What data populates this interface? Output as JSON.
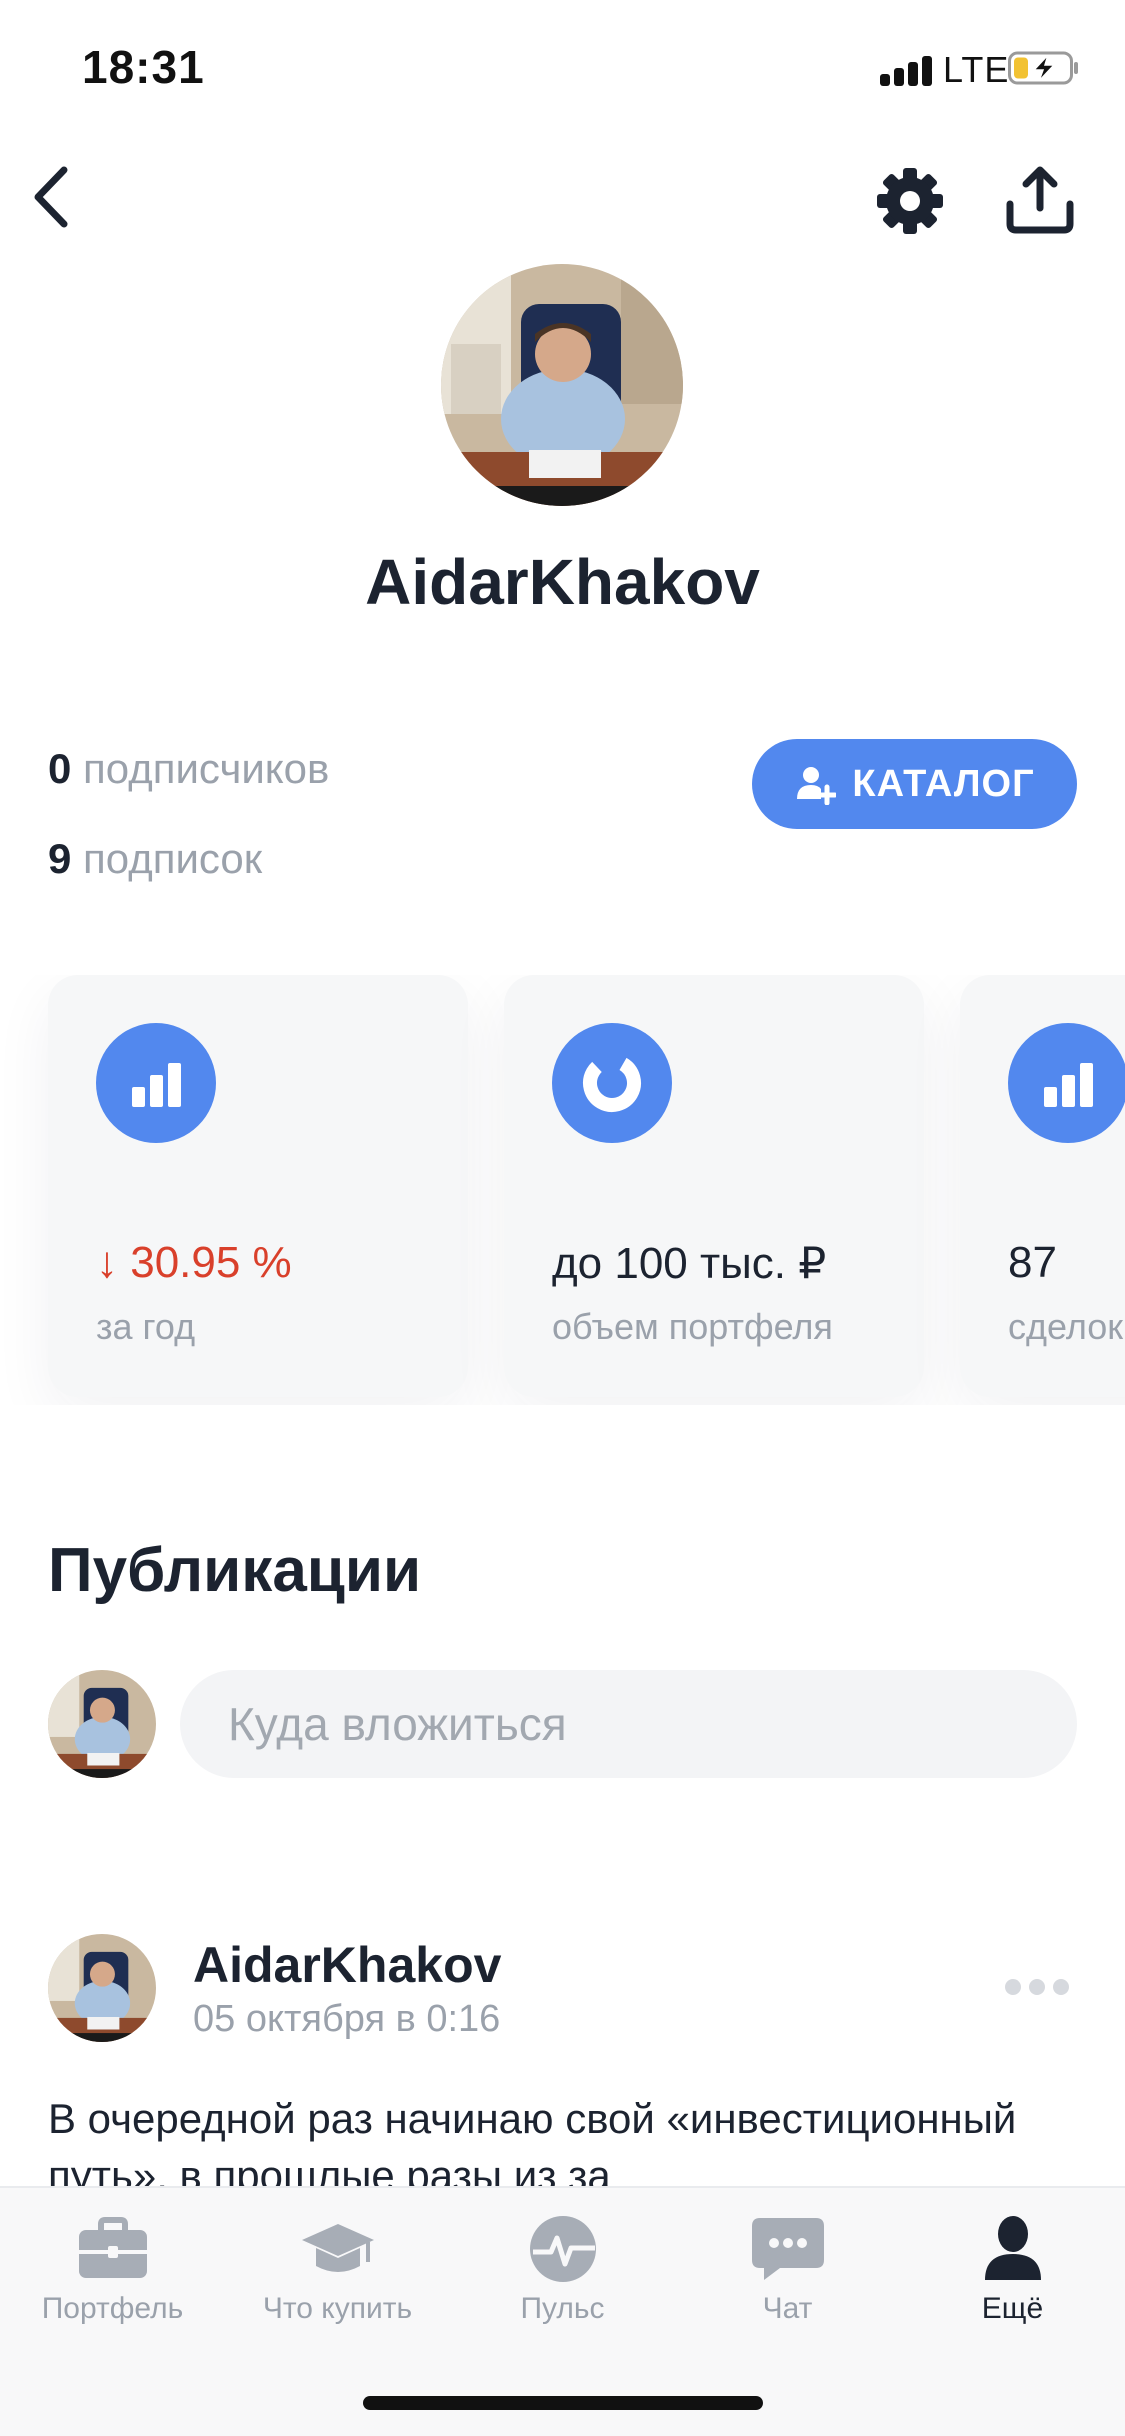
{
  "status_bar": {
    "time": "18:31",
    "network": "LTE"
  },
  "header": {
    "back_icon": "chevron-left-icon",
    "settings_icon": "gear-icon",
    "share_icon": "share-upload-icon"
  },
  "profile": {
    "username": "AidarKhakov",
    "followers_count": "0",
    "followers_label": "подписчиков",
    "following_count": "9",
    "following_label": "подписок",
    "catalog_button": "КАТАЛОГ"
  },
  "stats": [
    {
      "icon": "bar-chart-icon",
      "value": "↓ 30.95 %",
      "label": "за год",
      "trend": "negative"
    },
    {
      "icon": "donut-chart-icon",
      "value": "до 100 тыс. ₽",
      "label": "объем портфеля"
    },
    {
      "icon": "bar-chart-icon",
      "value": "87",
      "label": "сделок"
    }
  ],
  "publications": {
    "title": "Публикации",
    "compose_placeholder": "Куда вложиться"
  },
  "post": {
    "author": "AidarKhakov",
    "date": "05 октября в 0:16",
    "text": "В очередной раз начинаю свой «инвестиционный путь», в прошлые разы из за"
  },
  "tabs": [
    {
      "label": "Портфель",
      "icon": "briefcase-icon"
    },
    {
      "label": "Что купить",
      "icon": "graduation-cap-icon"
    },
    {
      "label": "Пульс",
      "icon": "pulse-icon"
    },
    {
      "label": "Чат",
      "icon": "chat-bubble-icon"
    },
    {
      "label": "Ещё",
      "icon": "person-icon",
      "active": true
    }
  ],
  "colors": {
    "accent": "#5288ee",
    "negative": "#d9402b",
    "muted": "#9aa1ab",
    "text": "#1c2330"
  }
}
